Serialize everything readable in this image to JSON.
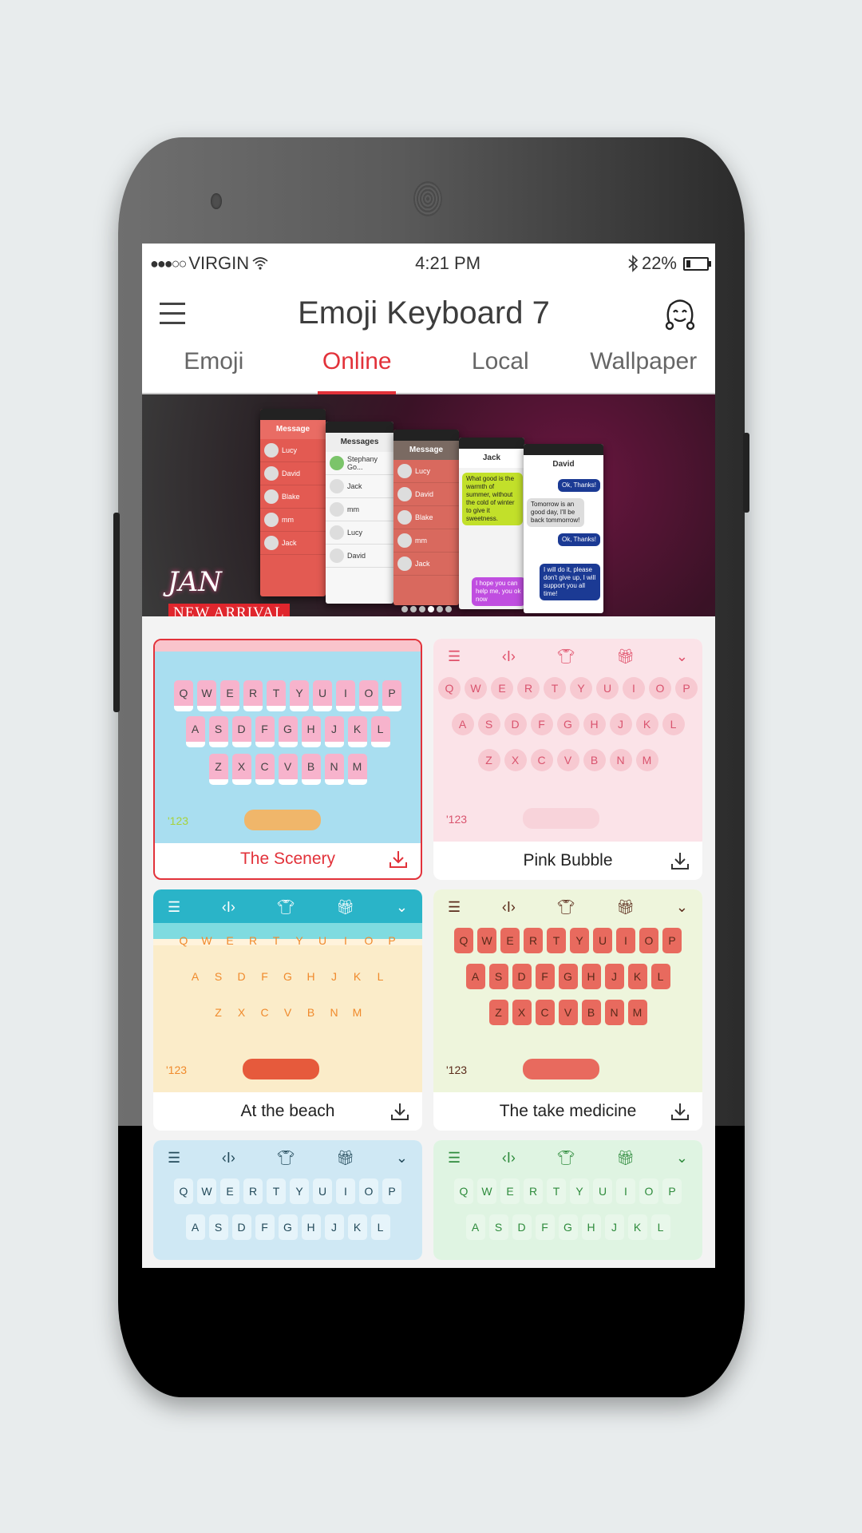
{
  "status_bar": {
    "signal": "●●●○○",
    "carrier": "VIRGIN",
    "time": "4:21 PM",
    "battery_percent_label": "22%",
    "battery_level": 0.22
  },
  "app_bar": {
    "title": "Emoji Keyboard 7",
    "menu_icon": "hamburger-icon",
    "profile_icon": "smiley-face-icon"
  },
  "tabs": [
    {
      "label": "Emoji",
      "active": false
    },
    {
      "label": "Online",
      "active": true
    },
    {
      "label": "Local",
      "active": false
    },
    {
      "label": "Wallpaper",
      "active": false
    }
  ],
  "banner": {
    "script_text": "JAN",
    "ribbon_text": "NEW ARRIVAL",
    "slide_count": 6,
    "active_slide": 4,
    "mock_headers": [
      "Message",
      "Messages",
      "Message",
      "Jack",
      "David"
    ],
    "mock_contacts": [
      "Lucy",
      "David",
      "Blake",
      "mm",
      "Jack"
    ],
    "mock_bubbles": [
      "What good is the warmth of summer, without the cold of winter to give it sweetness.",
      "Ok, Thanks!",
      "Tomorrow is an good day, I'll be back tommorrow!",
      "Ok, Thanks!",
      "I will do it, please don't give up, I will support you all time!",
      "I hope you can help me, you ok now"
    ]
  },
  "themes": [
    {
      "name": "The Scenery",
      "selected": true,
      "rows": [
        "QWERTYUIOP",
        "ASDFGHJKL",
        "ZXCVBNM"
      ],
      "bg": "#a9def0",
      "key_bg": "#f7b3cc",
      "key_color": "#444444",
      "bottom_label": "'123"
    },
    {
      "name": "Pink Bubble",
      "selected": false,
      "rows": [
        "QWERTYUIOP",
        "ASDFGHJKL",
        "ZXCVBNM"
      ],
      "bg": "#fbe3e8",
      "key_bg": "#f7c9d1",
      "key_color": "#d9546e",
      "bottom_label": "'123"
    },
    {
      "name": "At the beach",
      "selected": false,
      "rows": [
        "QWERTYUIOP",
        "ASDFGHJKL",
        "ZXCVBNM"
      ],
      "bg": "#fbecc9",
      "key_bg": "transparent",
      "key_color": "#f08a2c",
      "bottom_label": "'123"
    },
    {
      "name": "The take medicine",
      "selected": false,
      "rows": [
        "QWERTYUIOP",
        "ASDFGHJKL",
        "ZXCVBNM"
      ],
      "bg": "#eef5dc",
      "key_bg": "#e86a5e",
      "key_color": "#5a2a1a",
      "bottom_label": "'123"
    },
    {
      "name": "",
      "selected": false,
      "rows": [
        "QWERTYUIOP",
        "ASDFGHJKL"
      ],
      "bg": "#cfe8f4",
      "key_bg": "#e6f4fa",
      "key_color": "#234a5a",
      "bottom_label": ""
    },
    {
      "name": "",
      "selected": false,
      "rows": [
        "QWERTYUIOP",
        "ASDFGHJKL"
      ],
      "bg": "#dff4e2",
      "key_bg": "#e8f7ea",
      "key_color": "#2e8b3c",
      "bottom_label": ""
    }
  ],
  "colors": {
    "accent": "#e2323a",
    "title_text": "#3d3d3d",
    "tab_inactive": "#666666"
  }
}
